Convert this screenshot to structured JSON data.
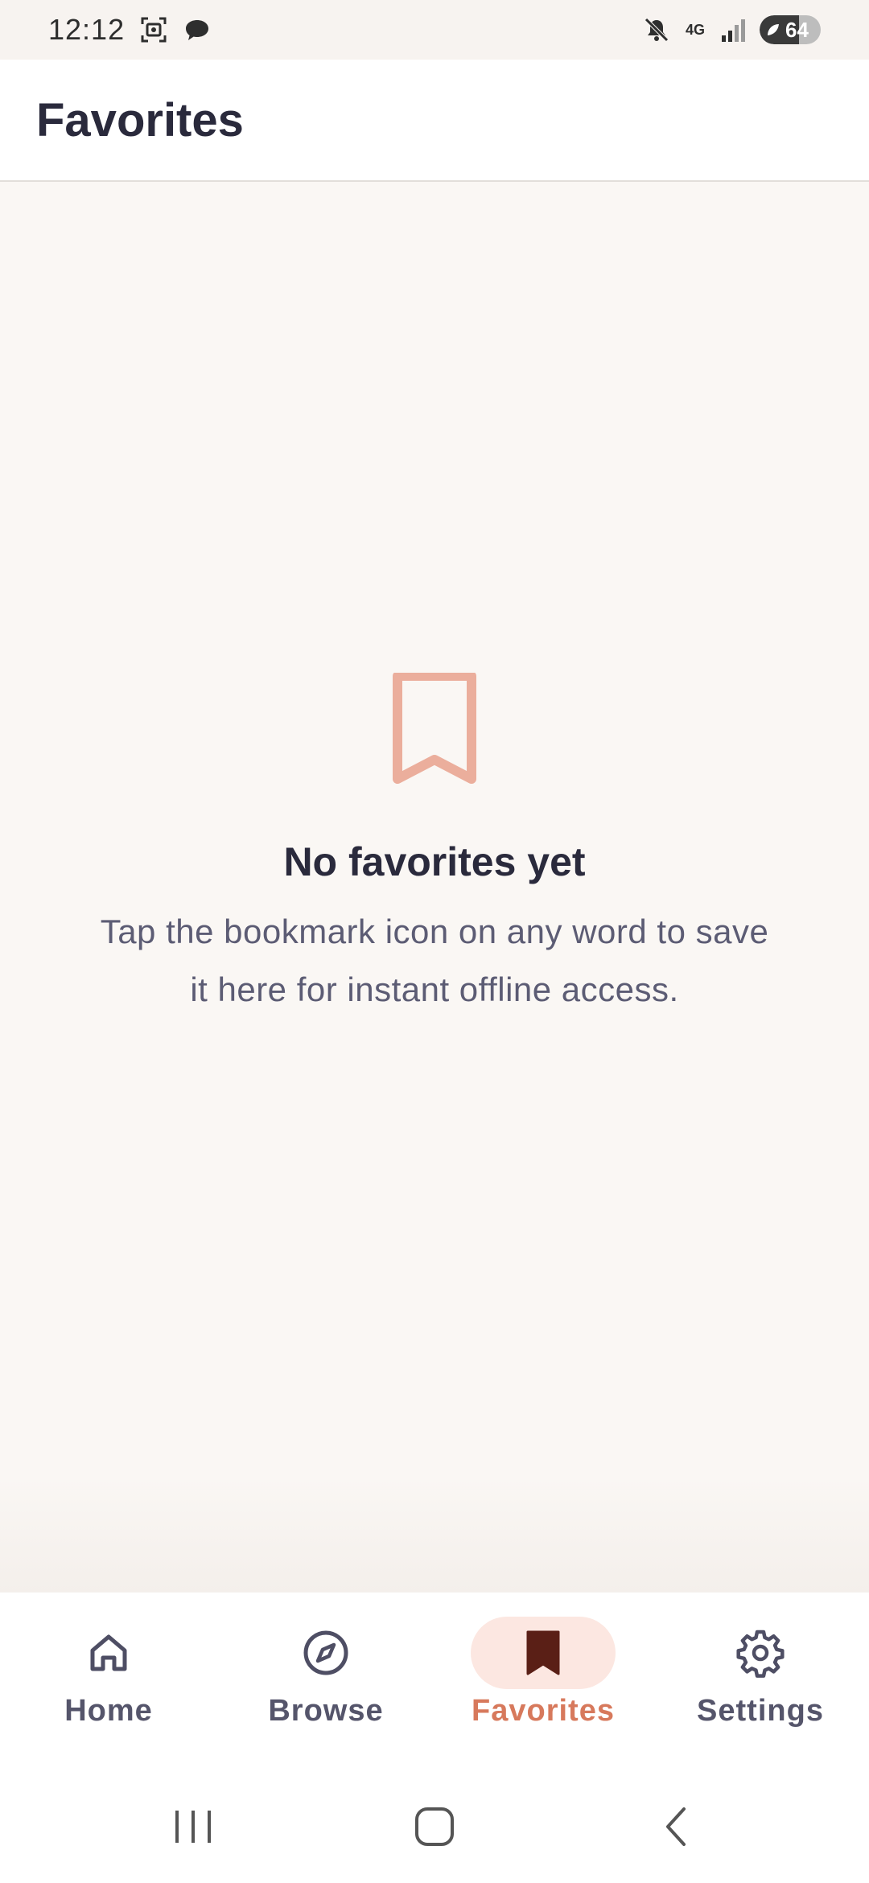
{
  "status_bar": {
    "time": "12:12",
    "network": "4G",
    "battery": "64"
  },
  "header": {
    "title": "Favorites"
  },
  "empty_state": {
    "icon": "bookmark-outline-icon",
    "title": "No favorites yet",
    "message": "Tap the bookmark icon on any word to save it here for instant offline access."
  },
  "bottom_nav": {
    "items": [
      {
        "label": "Home",
        "icon": "home-icon",
        "active": false
      },
      {
        "label": "Browse",
        "icon": "compass-icon",
        "active": false
      },
      {
        "label": "Favorites",
        "icon": "bookmark-icon",
        "active": true
      },
      {
        "label": "Settings",
        "icon": "gear-icon",
        "active": false
      }
    ]
  },
  "colors": {
    "background": "#FAF7F4",
    "accent": "#D7795C",
    "accent_soft": "#FCE7E1",
    "empty_icon": "#EBAE9C",
    "active_icon": "#5A1F16",
    "text_primary": "#2A2A3C",
    "text_secondary": "#5C5C74"
  }
}
